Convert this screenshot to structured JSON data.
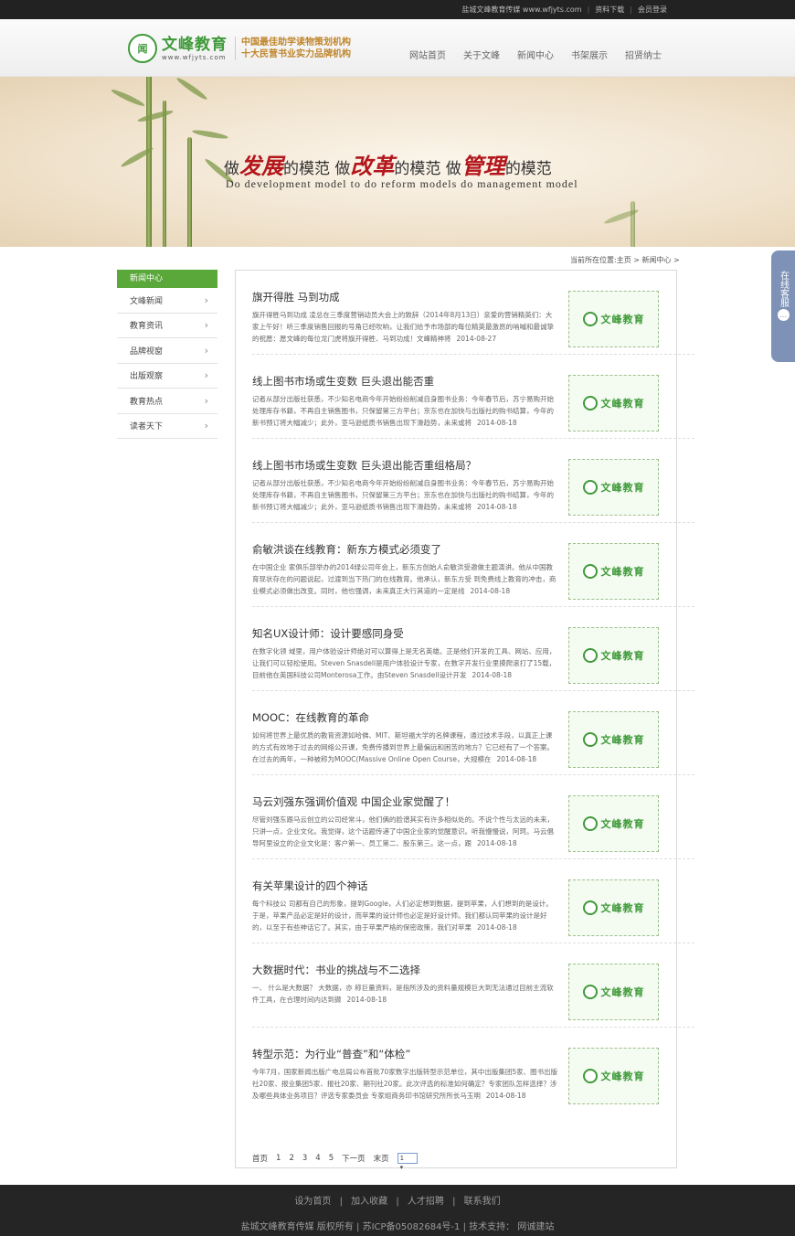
{
  "topbar": {
    "site": "盐城文峰教育传媒 www.wfjyts.com",
    "download": "资料下载",
    "login": "会员登录"
  },
  "logo": {
    "seal": "闻",
    "name": "文峰教育",
    "url": "www.wfjyts.com",
    "slogan1": "中国最佳助学读物策划机构",
    "slogan2": "十大民营书业实力品牌机构"
  },
  "nav": [
    "网站首页",
    "关于文峰",
    "新闻中心",
    "书架展示",
    "招贤纳士"
  ],
  "banner": {
    "p1": "做",
    "r1": "发展",
    "p2": "的模范  做",
    "r2": "改革",
    "p3": "的模范  做",
    "r3": "管理",
    "p4": "的模范",
    "en": "Do development model to do reform models do management model"
  },
  "breadcrumb": "当前所在位置:主页 > 新闻中心 >",
  "sidebar": {
    "head": "新闻中心",
    "items": [
      "文峰新闻",
      "教育资讯",
      "品牌视窗",
      "出版观察",
      "教育热点",
      "读者天下"
    ],
    "chevron": "›"
  },
  "thumb_text": "文峰教育",
  "articles": [
    {
      "title": "旗开得胜 马到功成",
      "desc": "旗开得胜马到功成 凌总在三季度营销动员大会上的致辞（2014年8月13日）亲爱的营销精英们：大家上午好！听三季度销售回报的号角已经吹响，让我们给予市场部的每位精英最激昂的呐喊和最诚挚的祝愿：愿文峰的每位龙门虎将旗开得胜、马到功成！文峰精神将",
      "date": "2014-08-27"
    },
    {
      "title": "线上图书市场或生变数 巨头退出能否重",
      "desc": "记者从部分出版社获悉，不少知名电商今年开始纷纷削减自身图书业务：今年春节后，苏宁易购开始处理库存书籍，不再自主销售图书，只保留第三方平台；京东也在加快与出版社的购书结算，今年的新书预订将大幅减少；此外，亚马逊纸质书销售出现下滑趋势，未来或将",
      "date": "2014-08-18"
    },
    {
      "title": "线上图书市场或生变数 巨头退出能否重组格局？",
      "desc": "记者从部分出版社获悉，不少知名电商今年开始纷纷削减自身图书业务：今年春节后，苏宁易购开始处理库存书籍，不再自主销售图书，只保留第三方平台；京东也在加快与出版社的购书结算，今年的新书预订将大幅减少；此外，亚马逊纸质书销售出现下滑趋势，未来或将",
      "date": "2014-08-18"
    },
    {
      "title": "俞敏洪谈在线教育：新东方模式必须变了",
      "desc": "在中国企业 家俱乐部举办的2014绿公司年会上，新东方创始人俞敏洪受邀做主题演讲。他从中国教育现状存在的问题说起，过渡到当下热门的在线教育。他承认，新东方受 到免费线上教育的冲击，商业模式必须做出改变。同时，他也强调，未来真正大行其道的一定是线",
      "date": "2014-08-18"
    },
    {
      "title": "知名UX设计师：设计要感同身受",
      "desc": "在数字化领 域里，用户体验设计师绝对可以算得上是无名英雄。正是他们开发的工具、网站、应用，让我们可以轻松使用。Steven Snasdell是用户体验设计专家，在数字开发行业里摸爬滚打了15载，目前他在英国科技公司Monterosa工作。由Steven Snasdell设计开发",
      "date": "2014-08-18"
    },
    {
      "title": "MOOC：在线教育的革命",
      "desc": "如何将世界上最优质的教育资源如哈佛、MIT、斯坦福大学的名牌课程，通过技术手段，以真正上课的方式有效地于过去的网络公开课，免费传播到世界上最偏远和困苦的地方？它已经有了一个答案。在过去的两年，一种被称为MOOC(Massive Online Open Course，大规模在",
      "date": "2014-08-18"
    },
    {
      "title": "马云刘强东强调价值观 中国企业家觉醒了！",
      "desc": "尽管刘强东跟马云创立的公司经常斗，他们俩的脸谱其实有许多相似处的。不说个性与太远的未来，只讲一点，企业文化。我觉得，这个话题传递了中国企业家的觉醒意识。听我慢慢说，阿珂。马云倡导阿里设立的企业文化是：客户第一、员工第二、股东第三。这一点，跟",
      "date": "2014-08-18"
    },
    {
      "title": "有关苹果设计的四个神话",
      "desc": "每个科技公 司都有自己的形象，提到Google，人们必定想到数据，提到苹果，人们想到的是设计。于是，苹果产品必定是好的设计，而苹果的设计师也必定是好设计师。我们都认同苹果的设计是好的，以至于有些神话它了。其实，由于苹果严格的保密政策，我们对苹果",
      "date": "2014-08-18"
    },
    {
      "title": "大数据时代：书业的挑战与不二选择",
      "desc": "一、 什么是大数据？ 大数据，亦 称巨量资料，是指所涉及的资料量规模巨大到无法通过目前主流软件工具，在合理时间内达到撷",
      "date": "2014-08-18"
    },
    {
      "title": "转型示范：为行业“普查”和“体检”",
      "desc": "今年7月，国家新闻出版广电总局公布首批70家数字出版转型示范单位，其中出版集团5家、图书出版社20家、报业集团5家、报社20家、期刊社20家。此次评选的标准如何确定？专家团队怎样选择？涉及哪些具体业务项目？评选专家委员会 专家组商务印书馆研究所所长马玉明",
      "date": "2014-08-18"
    }
  ],
  "pager": {
    "first": "首页",
    "pages": [
      "1",
      "2",
      "3",
      "4",
      "5"
    ],
    "next": "下一页",
    "last": "末页",
    "select": "1"
  },
  "service": {
    "label": "在线客服",
    "chat": "…"
  },
  "footer": {
    "links": [
      "设为首页",
      "|",
      "加入收藏",
      "|",
      "人才招聘",
      "|",
      "联系我们"
    ],
    "copyright": "盐城文峰教育传媒 版权所有 | 苏ICP备05082684号-1 | 技术支持： 网诚建站"
  }
}
